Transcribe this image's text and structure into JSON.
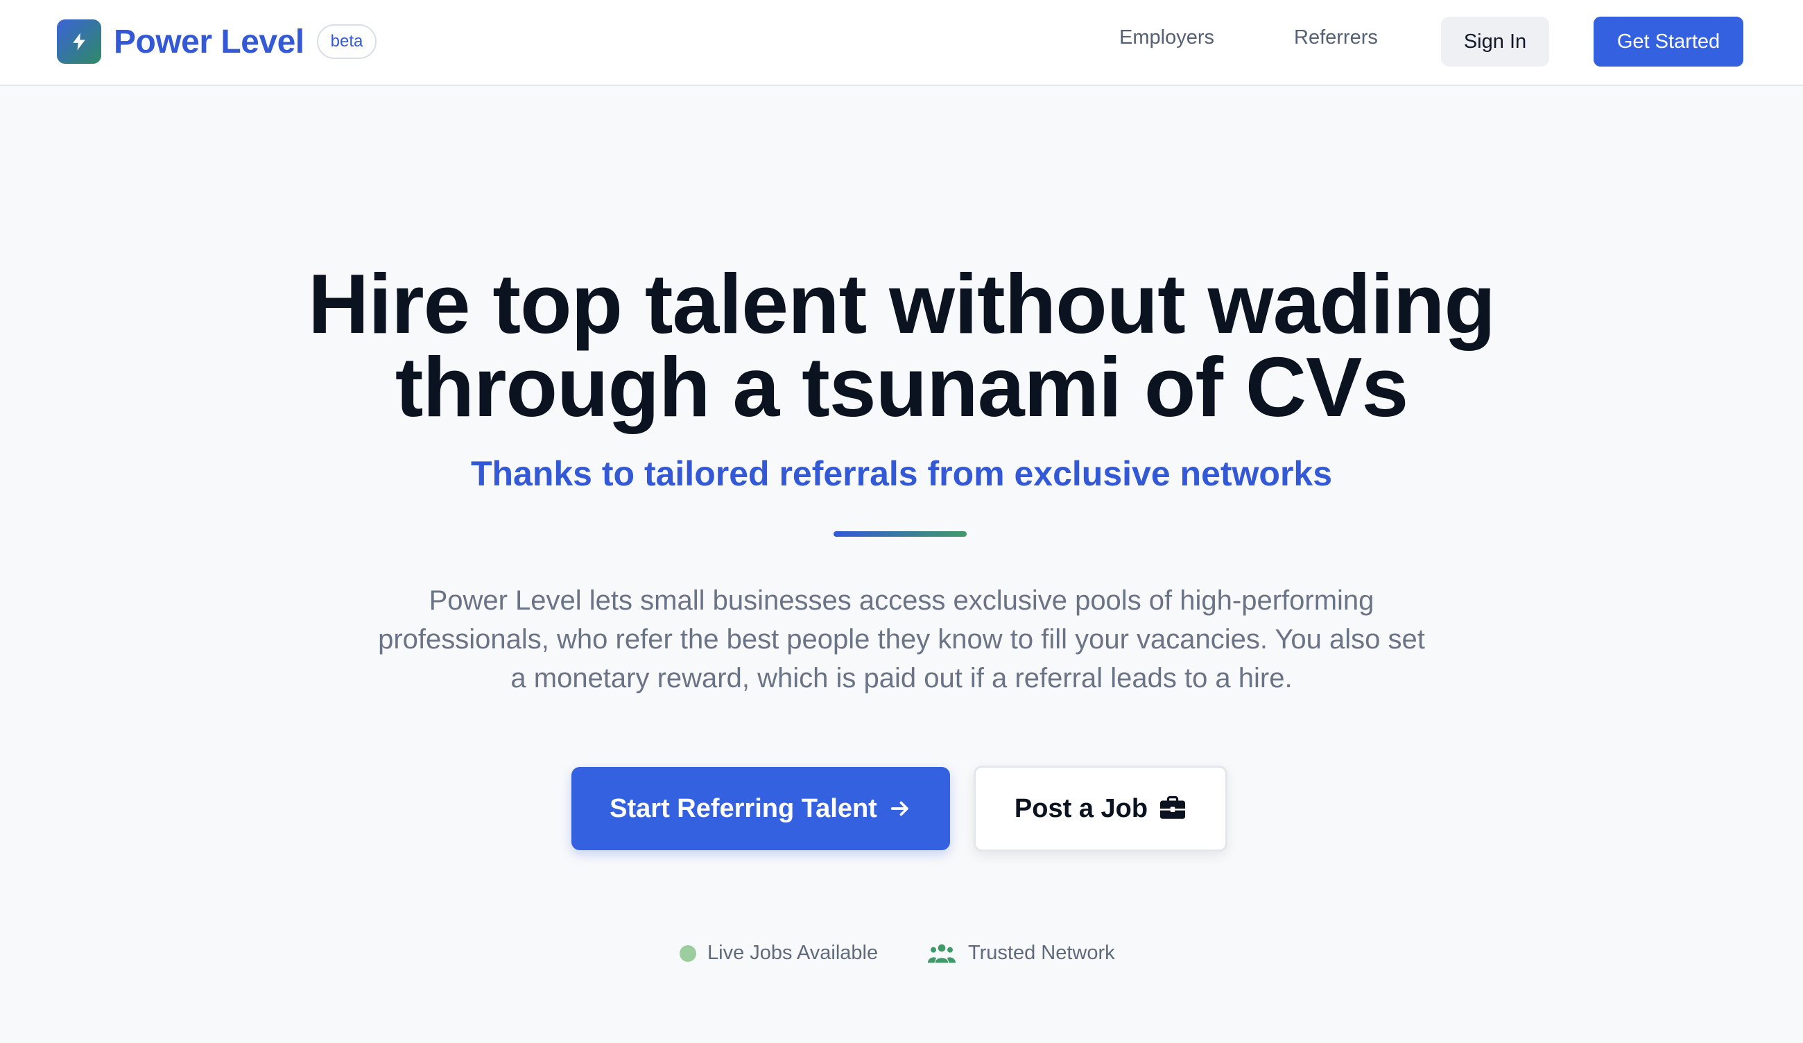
{
  "header": {
    "brand_name": "Power Level",
    "beta_label": "beta",
    "nav": [
      {
        "label": "Employers"
      },
      {
        "label": "Referrers"
      }
    ],
    "sign_in_label": "Sign In",
    "get_started_label": "Get Started",
    "logo_icon": "lightning-bolt-icon"
  },
  "hero": {
    "headline_line1": "Hire top talent without wading",
    "headline_line2": "through a tsunami of CVs",
    "subheadline": "Thanks to tailored referrals from exclusive networks",
    "description": "Power Level lets small businesses access exclusive pools of high-performing professionals, who refer the best people they know to fill your vacancies. You also set a monetary reward, which is paid out if a referral leads to a hire.",
    "primary_cta": "Start Referring Talent",
    "primary_cta_icon": "arrow-right-icon",
    "secondary_cta": "Post a Job",
    "secondary_cta_icon": "briefcase-icon"
  },
  "status": {
    "live_jobs": "Live Jobs Available",
    "trusted_network": "Trusted Network",
    "trusted_icon": "users-icon"
  },
  "colors": {
    "accent": "#3461e0",
    "brand_text": "#3359d6",
    "green": "#3f9a6a",
    "live_dot": "#9ccd9f"
  }
}
